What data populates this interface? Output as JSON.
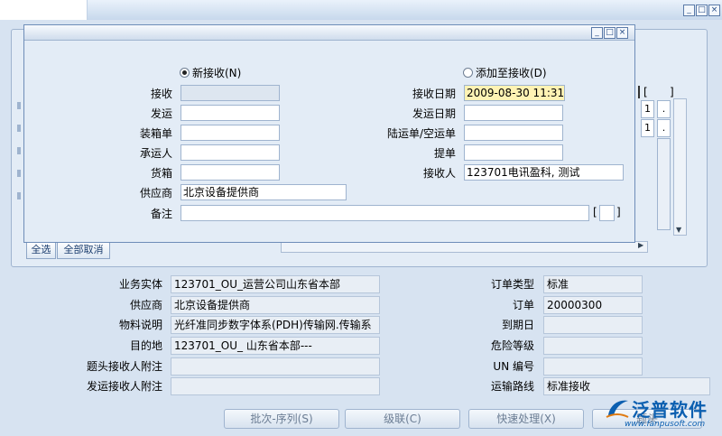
{
  "modal": {
    "radio_new": "新接收(N)",
    "radio_add": "添加至接收(D)",
    "left_labels": [
      "接收",
      "发运",
      "装箱单",
      "承运人",
      "货箱",
      "供应商",
      "备注"
    ],
    "left_values": [
      "",
      "",
      "",
      "",
      "",
      "北京设备提供商",
      ""
    ],
    "right_labels": [
      "接收日期",
      "发运日期",
      "陆运单/空运单",
      "提单",
      "接收人"
    ],
    "right_values": [
      "2009-08-30 11:31",
      "",
      "",
      "",
      "123701电讯盈科, 测试"
    ],
    "note_bracket_open": "[",
    "note_bracket_close": "]"
  },
  "background": {
    "select_all": "全选",
    "deselect_all": "全部取消",
    "grid_values": [
      "1",
      ".",
      "1",
      "."
    ],
    "bracket_open": "[",
    "bracket_close": "]"
  },
  "details": {
    "left_labels": [
      "业务实体",
      "供应商",
      "物料说明",
      "目的地",
      "题头接收人附注",
      "发运接收人附注"
    ],
    "left_values": [
      "123701_OU_运营公司山东省本部",
      "北京设备提供商",
      "光纤准同步数字体系(PDH)传输网.传输系",
      "123701_OU_ 山东省本部---",
      "",
      ""
    ],
    "right_labels": [
      "订单类型",
      "订单",
      "到期日",
      "危险等级",
      "UN 编号",
      "运输路线"
    ],
    "right_values": [
      "标准",
      "20000300",
      "",
      "",
      "",
      "标准接收"
    ]
  },
  "buttons": {
    "batch_serial": "批次-序列(S)",
    "cascade": "级联(C)",
    "quick_process": "快速处理(X)",
    "receipt_header": "题头"
  },
  "watermark": {
    "name": "泛普软件",
    "url": "www.fanpusoft.com"
  },
  "colors": {
    "accent": "#0b5fb0",
    "date_highlight": "#fff3b4",
    "panel": "#e3ecf6"
  }
}
